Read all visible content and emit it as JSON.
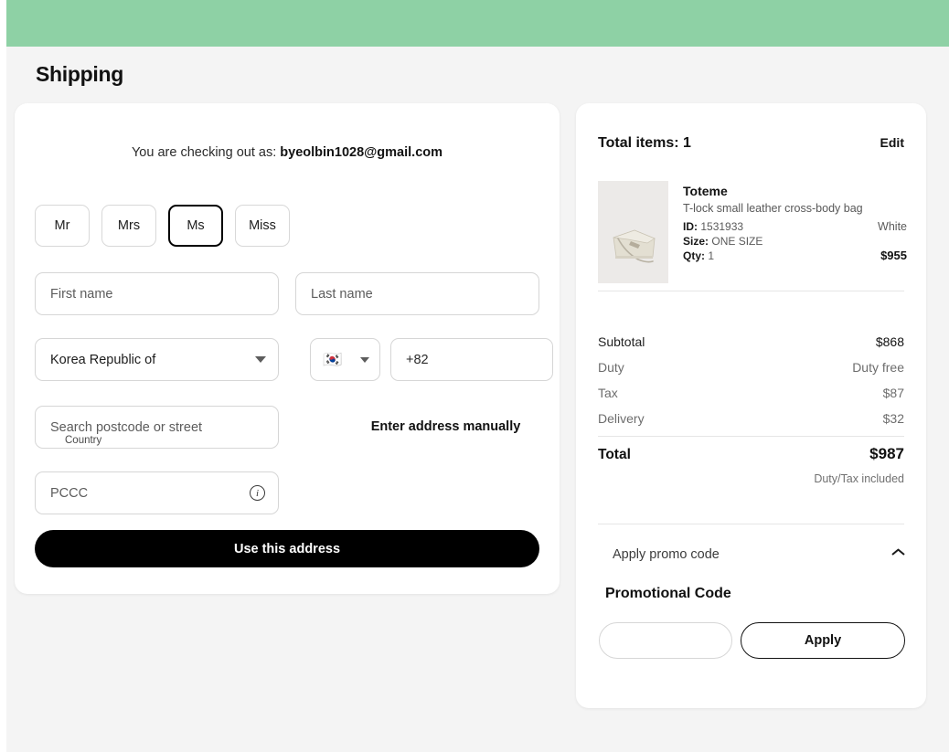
{
  "header": {
    "page_title": "Shipping",
    "bar_color": "#8ed1a5"
  },
  "shipping": {
    "checkout_prefix": "You are checking out as:",
    "email": "byeolbin1028@gmail.com",
    "titles": [
      {
        "label": "Mr",
        "selected": false
      },
      {
        "label": "Mrs",
        "selected": false
      },
      {
        "label": "Ms",
        "selected": true
      },
      {
        "label": "Miss",
        "selected": false
      }
    ],
    "first_name": {
      "placeholder": "First name",
      "value": ""
    },
    "last_name": {
      "placeholder": "Last name",
      "value": ""
    },
    "country": {
      "label": "Country",
      "value": "Korea Republic of"
    },
    "phone_country": {
      "flag": "🇰🇷",
      "icon": "kr-flag-icon"
    },
    "phone": {
      "value": "+82",
      "placeholder": "+82"
    },
    "postcode": {
      "placeholder": "Search postcode or street",
      "value": ""
    },
    "manual_address_link": "Enter address manually",
    "pccc": {
      "placeholder": "PCCC",
      "value": "",
      "info_icon": "info-icon"
    },
    "submit_label": "Use this address"
  },
  "summary": {
    "total_items_label": "Total items: 1",
    "edit_label": "Edit",
    "product": {
      "brand": "Toteme",
      "name": "T-lock small leather cross-body bag",
      "id_label": "ID:",
      "id_value": "1531933",
      "colour": "White",
      "size_label": "Size:",
      "size_value": "ONE SIZE",
      "qty_label": "Qty:",
      "qty_value": "1",
      "price": "$955"
    },
    "price_rows": [
      {
        "label": "Subtotal",
        "value": "$868",
        "strong": true
      },
      {
        "label": "Duty",
        "value": "Duty free",
        "strong": false
      },
      {
        "label": "Tax",
        "value": "$87",
        "strong": false
      },
      {
        "label": "Delivery",
        "value": "$32",
        "strong": false
      }
    ],
    "total_label": "Total",
    "total_value": "$987",
    "duty_note": "Duty/Tax included",
    "promo_toggle_label": "Apply promo code",
    "promo_heading": "Promotional Code",
    "promo_input": {
      "value": "",
      "placeholder": ""
    },
    "apply_label": "Apply"
  }
}
